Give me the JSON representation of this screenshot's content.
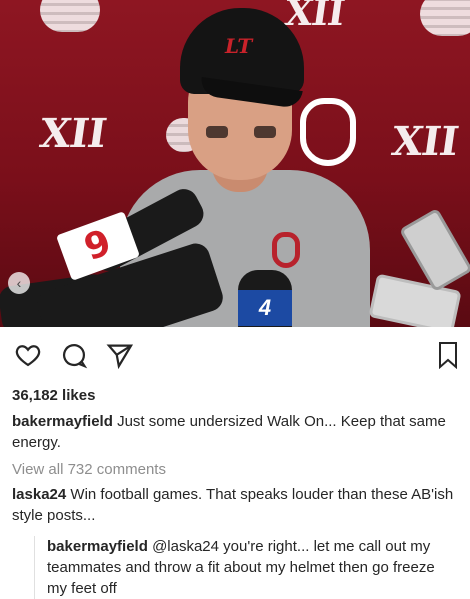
{
  "photo": {
    "cap_text": "LT",
    "backdrop_text": "XII",
    "mic_flag_text": "9",
    "mic_hd_text": "4"
  },
  "actions": {
    "like_icon": "heart-icon",
    "comment_icon": "comment-icon",
    "share_icon": "share-icon",
    "save_icon": "bookmark-icon"
  },
  "post": {
    "likes": "36,182 likes",
    "author": "bakermayfield",
    "caption": "Just some undersized Walk On... Keep that same energy.",
    "view_comments": "View all 732 comments"
  },
  "comments": [
    {
      "username": "laska24",
      "text": "Win football games. That speaks louder than these AB'ish style posts..."
    }
  ],
  "reply": {
    "username": "bakermayfield",
    "mention": "@laska24",
    "text": "you're right... let me call out my teammates and throw a fit about my helmet then go freeze my feet off"
  }
}
